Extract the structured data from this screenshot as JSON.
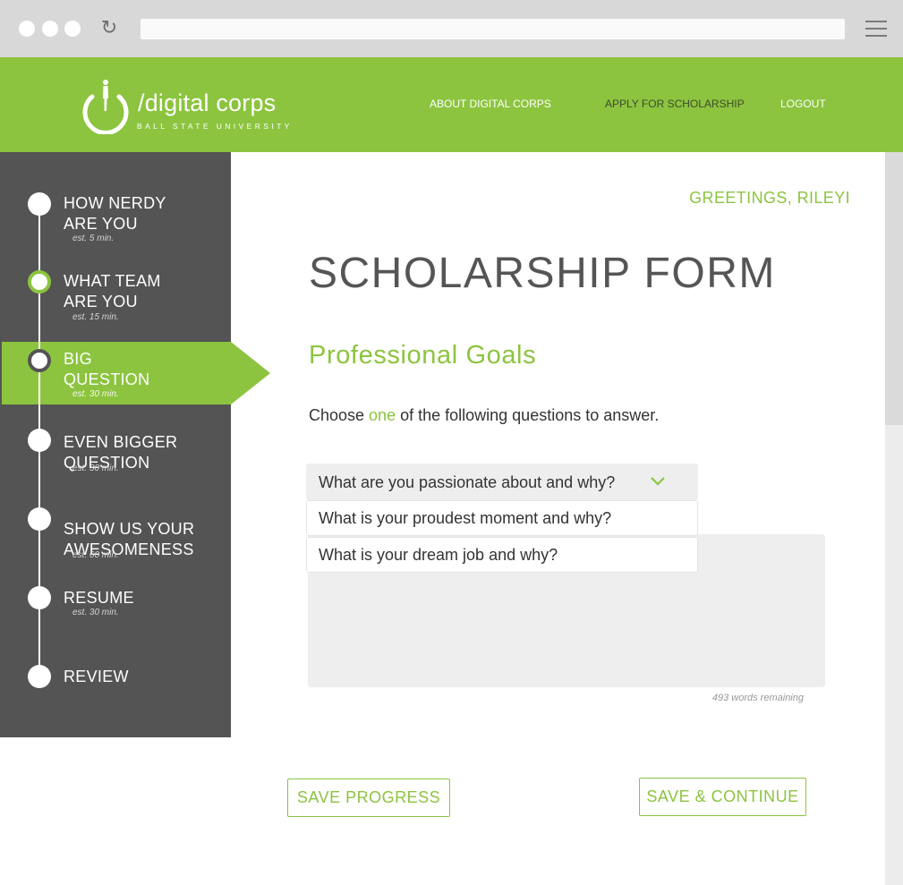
{
  "browser": {
    "reload_icon": "reload-icon",
    "menu_icon": "hamburger-menu-icon"
  },
  "header": {
    "logo_text": "/digital corps",
    "logo_subtext": "BALL STATE UNIVERSITY",
    "nav": [
      {
        "label": "ABOUT DIGITAL CORPS",
        "active": false
      },
      {
        "label": "APPLY FOR SCHOLARSHIP",
        "active": true
      },
      {
        "label": "LOGOUT",
        "active": false
      }
    ]
  },
  "sidebar": {
    "steps": [
      {
        "label": "HOW NERDY ARE YOU",
        "line1": "HOW NERDY",
        "line2": "ARE YOU",
        "est": "est. 5 min.",
        "state": "default"
      },
      {
        "label": "WHAT TEAM ARE YOU",
        "line1": "WHAT TEAM",
        "line2": "ARE YOU",
        "est": "est. 15 min.",
        "state": "in-progress"
      },
      {
        "label": "BIG QUESTION",
        "line1": "BIG",
        "line2": "QUESTION",
        "est": "est. 30 min.",
        "state": "active"
      },
      {
        "label": "EVEN BIGGER QUESTION",
        "line1": "EVEN BIGGER",
        "line2": "QUESTION",
        "est": "est. 30 min.",
        "state": "default"
      },
      {
        "label": "SHOW US YOUR AWESOMENESS",
        "line1": "SHOW US YOUR",
        "line2": "AWESOMENESS",
        "est": "est. 60 min.",
        "state": "default"
      },
      {
        "label": "RESUME",
        "line1": "RESUME",
        "line2": "",
        "est": "est. 30 min.",
        "state": "default"
      },
      {
        "label": "REVIEW",
        "line1": "REVIEW",
        "line2": "",
        "est": "",
        "state": "default"
      }
    ]
  },
  "main": {
    "greeting": "GREETINGS, RILEYI",
    "title": "SCHOLARSHIP FORM",
    "section": "Professional Goals",
    "instruction_pre": "Choose ",
    "instruction_hl": "one",
    "instruction_post": " of the following questions to answer.",
    "question_select": {
      "selected": "What are you passionate about and why?",
      "options": [
        "What is your proudest moment and why?",
        "What is your dream job and why?"
      ]
    },
    "answer_value": "",
    "words_remaining": "493 words remaining",
    "save_progress_label": "SAVE PROGRESS",
    "save_continue_label": "SAVE & CONTINUE"
  },
  "colors": {
    "brand_green": "#8cc43f",
    "sidebar_bg": "#545454",
    "chrome_bg": "#d8d8d8",
    "text_dark": "#555555"
  }
}
